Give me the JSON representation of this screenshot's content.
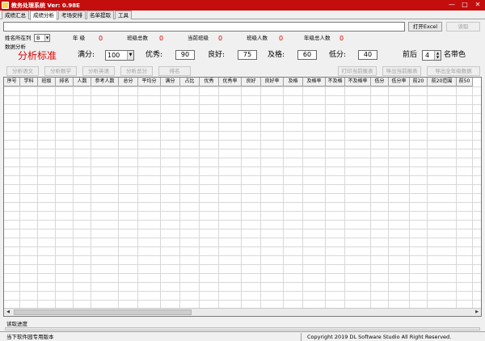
{
  "window": {
    "title": "教务处理系统 Ver: 0.98E",
    "minimize": "—",
    "restore": "□",
    "close": "✕"
  },
  "tabs": [
    "成绩汇总",
    "成绩分析",
    "考场安排",
    "名单提取",
    "工具"
  ],
  "toolbar": {
    "open_excel": "打开Excel",
    "read": "读取"
  },
  "info": {
    "name_col_label": "姓名所在列",
    "name_col_value": "B",
    "grade_label": "年  级",
    "grade_value": "0",
    "class_total_label": "班级总数",
    "class_total_value": "0",
    "current_class_label": "当前班级",
    "current_class_value": "0",
    "class_people_label": "班级人数",
    "class_people_value": "0",
    "grade_people_label": "年级总人数",
    "grade_people_value": "0"
  },
  "analysis": {
    "group_title": "数据分析",
    "standard_title": "分析标准",
    "full_label": "满分:",
    "full_value": "100",
    "excellent_label": "优秀:",
    "excellent_value": "90",
    "good_label": "良好:",
    "good_value": "75",
    "pass_label": "及格:",
    "pass_value": "60",
    "low_label": "低分:",
    "low_value": "40",
    "top_label": "前后",
    "top_value": "4",
    "top_suffix": "名带色"
  },
  "buttons": {
    "analyze_chinese": "分析语文",
    "analyze_math": "分析数学",
    "analyze_english": "分析英语",
    "analyze_total": "分析总分",
    "rank": "排名",
    "print_current": "打印当前报表",
    "export_current": "导出当前报表",
    "export_grade": "导出全年级数据"
  },
  "table": {
    "columns": [
      "序号",
      "学科",
      "班级",
      "排名",
      "人数",
      "参考人数",
      "总分",
      "平均分",
      "满分",
      "占比",
      "优秀",
      "优秀率",
      "良好",
      "良好率",
      "及格",
      "及格率",
      "不及格",
      "不及格率",
      "低分",
      "低分率",
      "前20",
      "前20范围",
      "前50"
    ]
  },
  "status": {
    "progress_label": "读取进度",
    "left": "当下软件园专用版本",
    "right": "Copyright 2019 DL Software Studio All Right Reserved."
  }
}
